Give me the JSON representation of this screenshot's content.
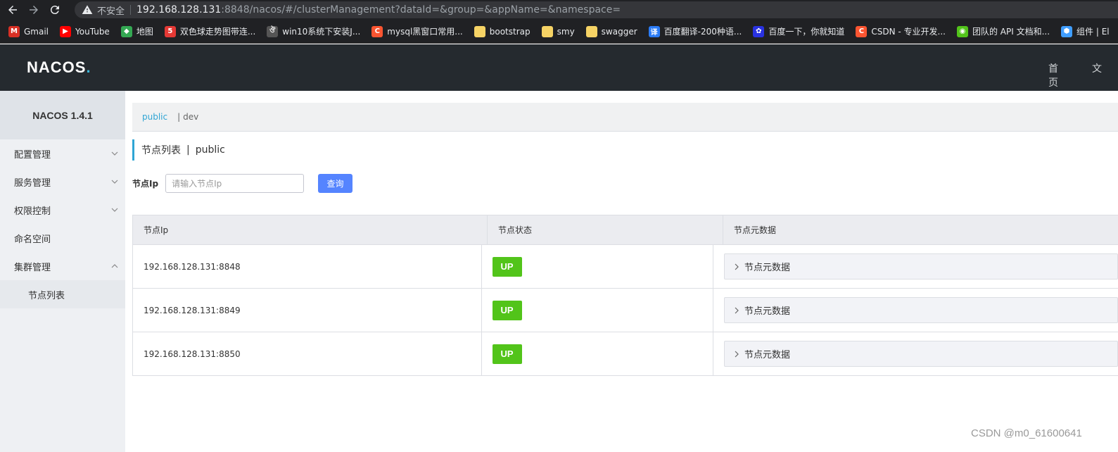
{
  "browser": {
    "insecure_label": "不安全",
    "url_host": "192.168.128.131",
    "url_rest": ":8848/nacos/#/clusterManagement?dataId=&group=&appName=&namespace=",
    "bookmarks": [
      {
        "label": "Gmail",
        "icon": "gmail-icon",
        "color": "#d93025",
        "glyph": "M"
      },
      {
        "label": "YouTube",
        "icon": "youtube-icon",
        "color": "#ff0000",
        "glyph": "▶"
      },
      {
        "label": "地图",
        "icon": "maps-icon",
        "color": "#34a853",
        "glyph": "◆"
      },
      {
        "label": "双色球走势图带连...",
        "icon": "five-icon",
        "color": "#e53935",
        "glyph": "5"
      },
      {
        "label": "win10系统下安装J...",
        "icon": "win-icon",
        "color": "#555555",
        "glyph": "ঔ"
      },
      {
        "label": "mysql黑窗口常用...",
        "icon": "csdn-icon",
        "color": "#fc5531",
        "glyph": "C"
      },
      {
        "label": "bootstrap",
        "icon": "folder-icon",
        "color": "#f6d365",
        "glyph": ""
      },
      {
        "label": "smy",
        "icon": "folder-icon",
        "color": "#f6d365",
        "glyph": ""
      },
      {
        "label": "swagger",
        "icon": "folder-icon",
        "color": "#f6d365",
        "glyph": ""
      },
      {
        "label": "百度翻译-200种语...",
        "icon": "translate-icon",
        "color": "#2b7cf6",
        "glyph": "译"
      },
      {
        "label": "百度一下，你就知道",
        "icon": "baidu-icon",
        "color": "#2932e1",
        "glyph": "✿"
      },
      {
        "label": "CSDN - 专业开发...",
        "icon": "csdn-icon",
        "color": "#fc5531",
        "glyph": "C"
      },
      {
        "label": "团队的 API 文档和...",
        "icon": "api-icon",
        "color": "#52c41a",
        "glyph": "◉"
      },
      {
        "label": "组件 | El",
        "icon": "element-icon",
        "color": "#409eff",
        "glyph": "⬢"
      }
    ]
  },
  "header": {
    "logo_text": "NACOS",
    "logo_dot": ".",
    "nav": [
      "首页",
      "文"
    ]
  },
  "sidebar": {
    "title": "NACOS 1.4.1",
    "items": [
      {
        "label": "配置管理",
        "expanded": false,
        "has_chevron": true
      },
      {
        "label": "服务管理",
        "expanded": false,
        "has_chevron": true
      },
      {
        "label": "权限控制",
        "expanded": false,
        "has_chevron": true
      },
      {
        "label": "命名空间",
        "has_chevron": false
      },
      {
        "label": "集群管理",
        "expanded": true,
        "has_chevron": true
      }
    ],
    "sub_item": "节点列表"
  },
  "namespace_bar": {
    "active": "public",
    "separator": "|",
    "other": "dev"
  },
  "page": {
    "title": "节点列表",
    "separator": "|",
    "namespace": "public"
  },
  "search": {
    "label": "节点Ip",
    "placeholder": "请输入节点Ip",
    "value": "",
    "button": "查询"
  },
  "table": {
    "columns": [
      "节点Ip",
      "节点状态",
      "节点元数据"
    ],
    "rows": [
      {
        "ip": "192.168.128.131:8848",
        "state": "UP",
        "meta": "节点元数据"
      },
      {
        "ip": "192.168.128.131:8849",
        "state": "UP",
        "meta": "节点元数据"
      },
      {
        "ip": "192.168.128.131:8850",
        "state": "UP",
        "meta": "节点元数据"
      }
    ]
  },
  "watermark": "CSDN @m0_61600641",
  "colors": {
    "accent": "#2fa5d4",
    "button": "#5584ff",
    "status_up": "#52c41a",
    "header_bg": "#252a2f"
  }
}
